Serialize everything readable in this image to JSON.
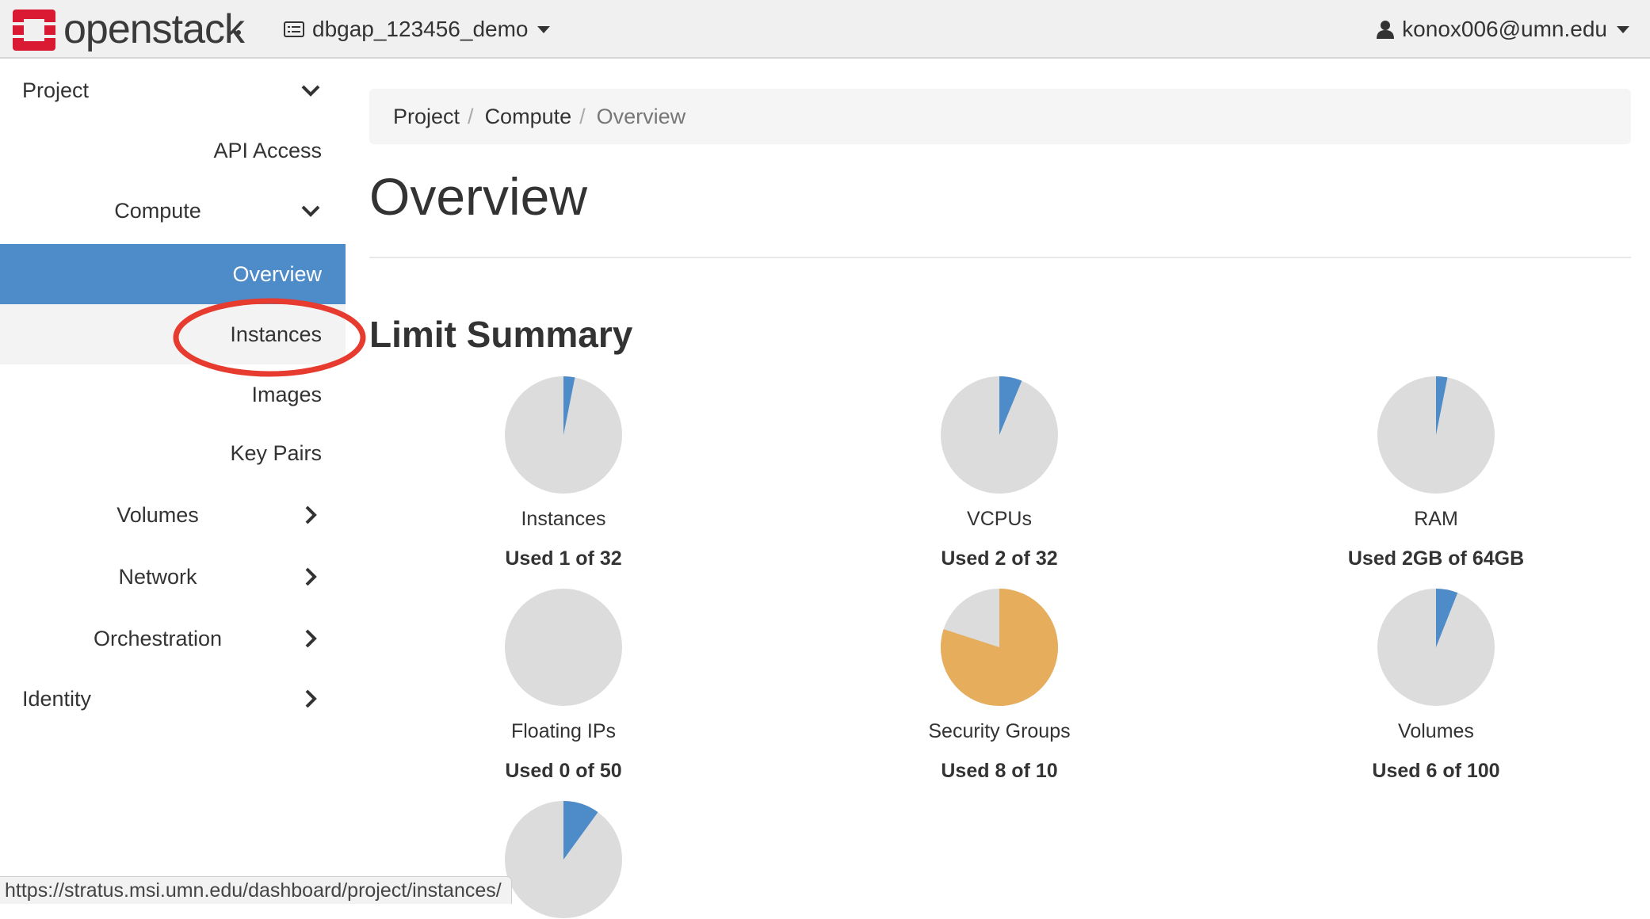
{
  "header": {
    "brand": "openstack",
    "project_name": "dbgap_123456_demo",
    "user_email": "konox006@umn.edu",
    "icons": {
      "logo": "openstack-logo",
      "project": "project-list-icon",
      "user": "user-icon"
    },
    "colors": {
      "brand_red": "#da1a32"
    }
  },
  "sidebar": {
    "accent": "#4e8bc9",
    "items": [
      {
        "label": "Project",
        "chevron": "down"
      },
      {
        "label": "API Access"
      },
      {
        "label": "Compute",
        "chevron": "down"
      },
      {
        "label": "Overview",
        "active": true
      },
      {
        "label": "Instances",
        "highlighted": true
      },
      {
        "label": "Images"
      },
      {
        "label": "Key Pairs"
      },
      {
        "label": "Volumes",
        "chevron": "right"
      },
      {
        "label": "Network",
        "chevron": "right"
      },
      {
        "label": "Orchestration",
        "chevron": "right"
      },
      {
        "label": "Identity",
        "chevron": "right"
      }
    ]
  },
  "breadcrumb": {
    "items": [
      "Project",
      "Compute",
      "Overview"
    ],
    "separator": "/"
  },
  "page": {
    "title": "Overview",
    "section_title": "Limit Summary"
  },
  "pie_colors": {
    "used": "#4e8bc9",
    "warning": "#e6ad5c",
    "remaining": "#dcdcdc"
  },
  "limits": [
    {
      "label": "Instances",
      "used_text": "Used 1 of 32",
      "used": 1,
      "total": 32,
      "status": "normal"
    },
    {
      "label": "VCPUs",
      "used_text": "Used 2 of 32",
      "used": 2,
      "total": 32,
      "status": "normal"
    },
    {
      "label": "RAM",
      "used_text": "Used 2GB of 64GB",
      "used": 2,
      "total": 64,
      "status": "normal"
    },
    {
      "label": "Floating IPs",
      "used_text": "Used 0 of 50",
      "used": 0,
      "total": 50,
      "status": "normal"
    },
    {
      "label": "Security Groups",
      "used_text": "Used 8 of 10",
      "used": 8,
      "total": 10,
      "status": "warning"
    },
    {
      "label": "Volumes",
      "used_text": "Used 6 of 100",
      "used": 6,
      "total": 100,
      "status": "normal"
    },
    {
      "label": "",
      "used_text": "",
      "used": 1,
      "total": 10,
      "status": "normal"
    }
  ],
  "status_bar": {
    "url": "https://stratus.msi.umn.edu/dashboard/project/instances/"
  }
}
